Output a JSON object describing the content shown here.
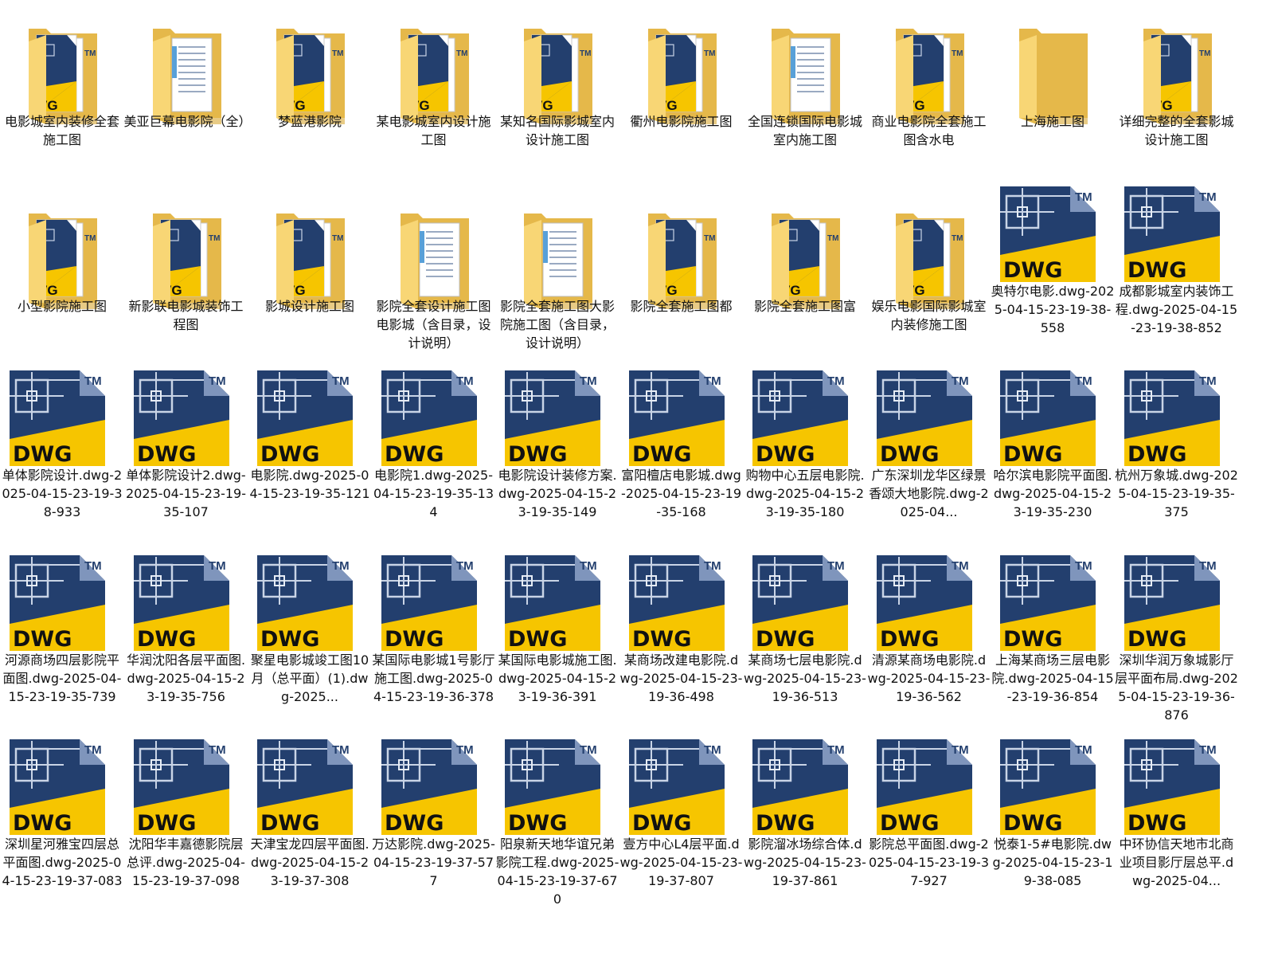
{
  "items": [
    {
      "type": "folder",
      "variant": "dwg",
      "label": "电影城室内装修全套施工图"
    },
    {
      "type": "folder",
      "variant": "doc",
      "label": "美亚巨幕电影院（全）"
    },
    {
      "type": "folder",
      "variant": "dwg",
      "label": "梦蓝港影院"
    },
    {
      "type": "folder",
      "variant": "dwg",
      "label": "某电影城室内设计施工图"
    },
    {
      "type": "folder",
      "variant": "dwg",
      "label": "某知名国际影城室内设计施工图"
    },
    {
      "type": "folder",
      "variant": "dwg",
      "label": "衢州电影院施工图"
    },
    {
      "type": "folder",
      "variant": "doc",
      "label": "全国连锁国际电影城室内施工图"
    },
    {
      "type": "folder",
      "variant": "dwg",
      "label": "商业电影院全套施工图含水电"
    },
    {
      "type": "folder",
      "variant": "plain",
      "label": "上海施工图"
    },
    {
      "type": "folder",
      "variant": "dwg",
      "label": "详细完整的全套影城设计施工图"
    },
    {
      "type": "folder",
      "variant": "dwg",
      "label": "小型影院施工图"
    },
    {
      "type": "folder",
      "variant": "dwg",
      "label": "新影联电影城装饰工程图"
    },
    {
      "type": "folder",
      "variant": "dwg",
      "label": "影城设计施工图"
    },
    {
      "type": "folder",
      "variant": "doc",
      "label": "影院全套设计施工图电影城（含目录，设计说明）"
    },
    {
      "type": "folder",
      "variant": "doc",
      "label": "影院全套施工图大影院施工图（含目录，设计说明）"
    },
    {
      "type": "folder",
      "variant": "dwg",
      "label": "影院全套施工图都"
    },
    {
      "type": "folder",
      "variant": "dwg",
      "label": "影院全套施工图富"
    },
    {
      "type": "folder",
      "variant": "dwg",
      "label": "娱乐电影国际影城室内装修施工图"
    },
    {
      "type": "dwg",
      "label": "奥特尔电影.dwg-2025-04-15-23-19-38-558"
    },
    {
      "type": "dwg",
      "label": "成都影城室内装饰工程.dwg-2025-04-15-23-19-38-852"
    },
    {
      "type": "dwg",
      "label": "单体影院设计.dwg-2025-04-15-23-19-38-933"
    },
    {
      "type": "dwg",
      "label": "单体影院设计2.dwg-2025-04-15-23-19-35-107"
    },
    {
      "type": "dwg",
      "label": "电影院.dwg-2025-04-15-23-19-35-121"
    },
    {
      "type": "dwg",
      "label": "电影院1.dwg-2025-04-15-23-19-35-134"
    },
    {
      "type": "dwg",
      "label": "电影院设计装修方案.dwg-2025-04-15-23-19-35-149"
    },
    {
      "type": "dwg",
      "label": "富阳檀店电影城.dwg-2025-04-15-23-19-35-168"
    },
    {
      "type": "dwg",
      "label": "购物中心五层电影院.dwg-2025-04-15-23-19-35-180"
    },
    {
      "type": "dwg",
      "label": "广东深圳龙华区绿景香颂大地影院.dwg-2025-04..."
    },
    {
      "type": "dwg",
      "label": "哈尔滨电影院平面图.dwg-2025-04-15-23-19-35-230"
    },
    {
      "type": "dwg",
      "label": "杭州万象城.dwg-2025-04-15-23-19-35-375"
    },
    {
      "type": "dwg",
      "label": "河源商场四层影院平面图.dwg-2025-04-15-23-19-35-739"
    },
    {
      "type": "dwg",
      "label": "华润沈阳各层平面图.dwg-2025-04-15-23-19-35-756"
    },
    {
      "type": "dwg",
      "label": "聚星电影城竣工图10月（总平面）(1).dwg-2025..."
    },
    {
      "type": "dwg",
      "label": "某国际电影城1号影厅施工图.dwg-2025-04-15-23-19-36-378"
    },
    {
      "type": "dwg",
      "label": "某国际电影城施工图.dwg-2025-04-15-23-19-36-391"
    },
    {
      "type": "dwg",
      "label": "某商场改建电影院.dwg-2025-04-15-23-19-36-498"
    },
    {
      "type": "dwg",
      "label": "某商场七层电影院.dwg-2025-04-15-23-19-36-513"
    },
    {
      "type": "dwg",
      "label": "清源某商场电影院.dwg-2025-04-15-23-19-36-562"
    },
    {
      "type": "dwg",
      "label": "上海某商场三层电影院.dwg-2025-04-15-23-19-36-854"
    },
    {
      "type": "dwg",
      "label": "深圳华润万象城影厅层平面布局.dwg-2025-04-15-23-19-36-876"
    },
    {
      "type": "dwg",
      "label": "深圳星河雅宝四层总平面图.dwg-2025-04-15-23-19-37-083"
    },
    {
      "type": "dwg",
      "label": "沈阳华丰嘉德影院层总评.dwg-2025-04-15-23-19-37-098"
    },
    {
      "type": "dwg",
      "label": "天津宝龙四层平面图.dwg-2025-04-15-23-19-37-308"
    },
    {
      "type": "dwg",
      "label": "万达影院.dwg-2025-04-15-23-19-37-577"
    },
    {
      "type": "dwg",
      "label": "阳泉新天地华谊兄弟影院工程.dwg-2025-04-15-23-19-37-670"
    },
    {
      "type": "dwg",
      "label": "壹方中心L4层平面.dwg-2025-04-15-23-19-37-807"
    },
    {
      "type": "dwg",
      "label": "影院溜冰场综合体.dwg-2025-04-15-23-19-37-861"
    },
    {
      "type": "dwg",
      "label": "影院总平面图.dwg-2025-04-15-23-19-37-927"
    },
    {
      "type": "dwg",
      "label": "悦泰1-5#电影院.dwg-2025-04-15-23-19-38-085"
    },
    {
      "type": "dwg",
      "label": "中环协信天地市北商业项目影厅层总平.dwg-2025-04..."
    }
  ],
  "icon_text": {
    "dwg": "DWG",
    "tm": "TM"
  },
  "colors": {
    "folder_back": "#E5B84A",
    "folder_front": "#F8D675",
    "dwg_navy": "#233F6E",
    "dwg_yellow": "#F6C500",
    "paper": "#FFFFFF"
  },
  "icon_names": {
    "folder": "folder-icon",
    "dwg": "dwg-file-icon"
  }
}
